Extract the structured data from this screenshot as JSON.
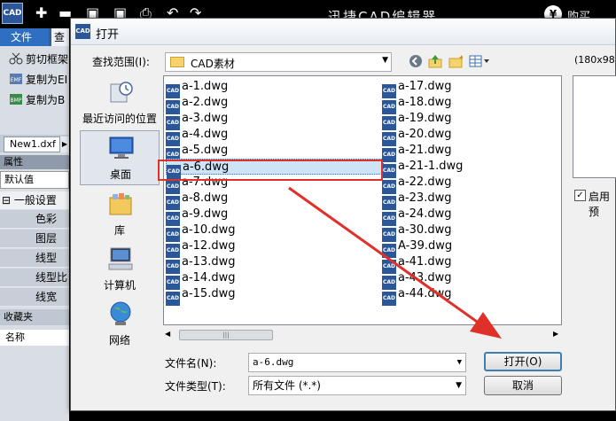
{
  "app": {
    "title": "迅捷CAD编辑器",
    "logo": "CAD",
    "buy_label": "购买",
    "yen_symbol": "¥",
    "toolbar_icons": [
      "new-icon",
      "open-icon",
      "save-icon",
      "save-as-icon",
      "print-icon",
      "undo-icon",
      "redo-icon"
    ]
  },
  "menu": {
    "file": "文件",
    "view": "查"
  },
  "left_panel": {
    "ribbon": [
      {
        "label": "剪切框架",
        "icon": "scissors-icon"
      },
      {
        "label": "复制为EI",
        "icon": "emf-icon",
        "badge": "EMF"
      },
      {
        "label": "复制为B",
        "icon": "bmp-icon",
        "badge": "BMP"
      }
    ],
    "document_tab": "New1.dxf",
    "properties_header": "属性",
    "default_value": "默认值",
    "general_group": "一般设置",
    "properties": [
      "色彩",
      "图层",
      "线型",
      "线型比",
      "线宽"
    ],
    "favorites_header": "收藏夹",
    "name_header": "名称"
  },
  "dialog": {
    "title": "打开",
    "icon_text": "CAD",
    "look_in_label": "查找范围(I):",
    "look_in_value": "CAD素材",
    "places": [
      {
        "label": "最近访问的位置",
        "icon": "recent-places-icon"
      },
      {
        "label": "桌面",
        "icon": "desktop-icon"
      },
      {
        "label": "库",
        "icon": "library-icon"
      },
      {
        "label": "计算机",
        "icon": "computer-icon"
      },
      {
        "label": "网络",
        "icon": "network-icon"
      }
    ],
    "files_col1": [
      "a-1.dwg",
      "a-2.dwg",
      "a-3.dwg",
      "a-4.dwg",
      "a-5.dwg",
      "a-6.dwg",
      "a-7.dwg",
      "a-8.dwg",
      "a-9.dwg",
      "a-10.dwg",
      "a-12.dwg",
      "a-13.dwg",
      "a-14.dwg",
      "a-15.dwg"
    ],
    "files_col2": [
      "a-17.dwg",
      "a-18.dwg",
      "a-19.dwg",
      "a-20.dwg",
      "a-21.dwg",
      "a-21-1.dwg",
      "a-22.dwg",
      "a-23.dwg",
      "a-24.dwg",
      "a-30.dwg",
      "A-39.dwg",
      "a-41.dwg",
      "a-43.dwg",
      "a-44.dwg"
    ],
    "file_icon_text": "CAD",
    "selected_file": "a-6.dwg",
    "file_name_label": "文件名(N):",
    "file_name_value": "a-6.dwg",
    "file_type_label": "文件类型(T):",
    "file_type_value": "所有文件 (*.*)",
    "open_button": "打开(O)",
    "cancel_button": "取消",
    "preview_size": "(180x98)",
    "preview_checkbox": "启用预"
  },
  "colors": {
    "accent": "#2b579a",
    "highlight": "#e0302a",
    "selection": "#cde3f7"
  }
}
